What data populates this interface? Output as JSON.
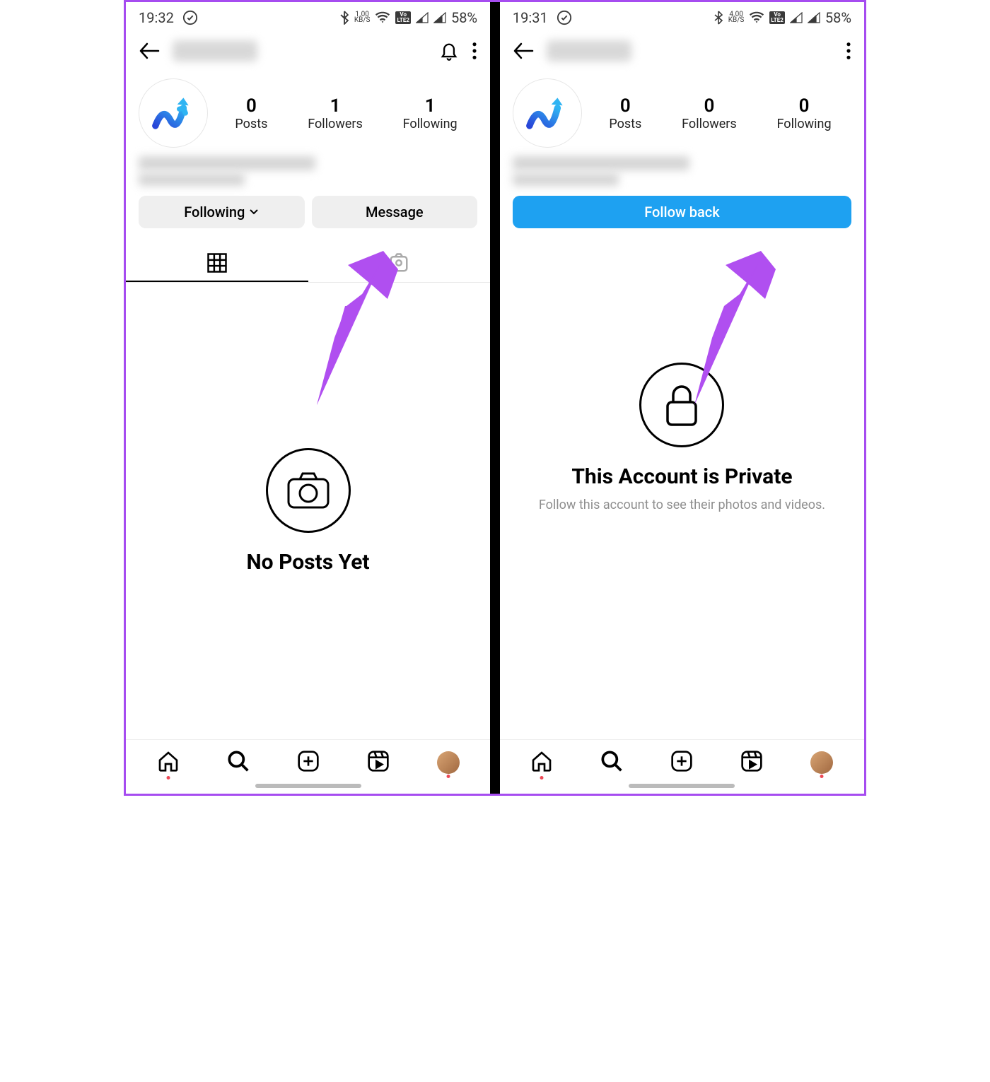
{
  "left": {
    "status": {
      "time": "19:32",
      "speed_num": "1.00",
      "speed_unit": "KB/S",
      "lte": "VoLTE2",
      "battery": "58%"
    },
    "stats": {
      "posts": {
        "num": "0",
        "label": "Posts"
      },
      "followers": {
        "num": "1",
        "label": "Followers"
      },
      "following": {
        "num": "1",
        "label": "Following"
      }
    },
    "buttons": {
      "following": "Following",
      "message": "Message"
    },
    "empty_title": "No Posts Yet"
  },
  "right": {
    "status": {
      "time": "19:31",
      "speed_num": "4.00",
      "speed_unit": "KB/S",
      "lte": "VoLTE2",
      "battery": "58%"
    },
    "stats": {
      "posts": {
        "num": "0",
        "label": "Posts"
      },
      "followers": {
        "num": "0",
        "label": "Followers"
      },
      "following": {
        "num": "0",
        "label": "Following"
      }
    },
    "buttons": {
      "follow_back": "Follow back"
    },
    "private_title": "This Account is Private",
    "private_sub": "Follow this account to see their photos and videos."
  }
}
